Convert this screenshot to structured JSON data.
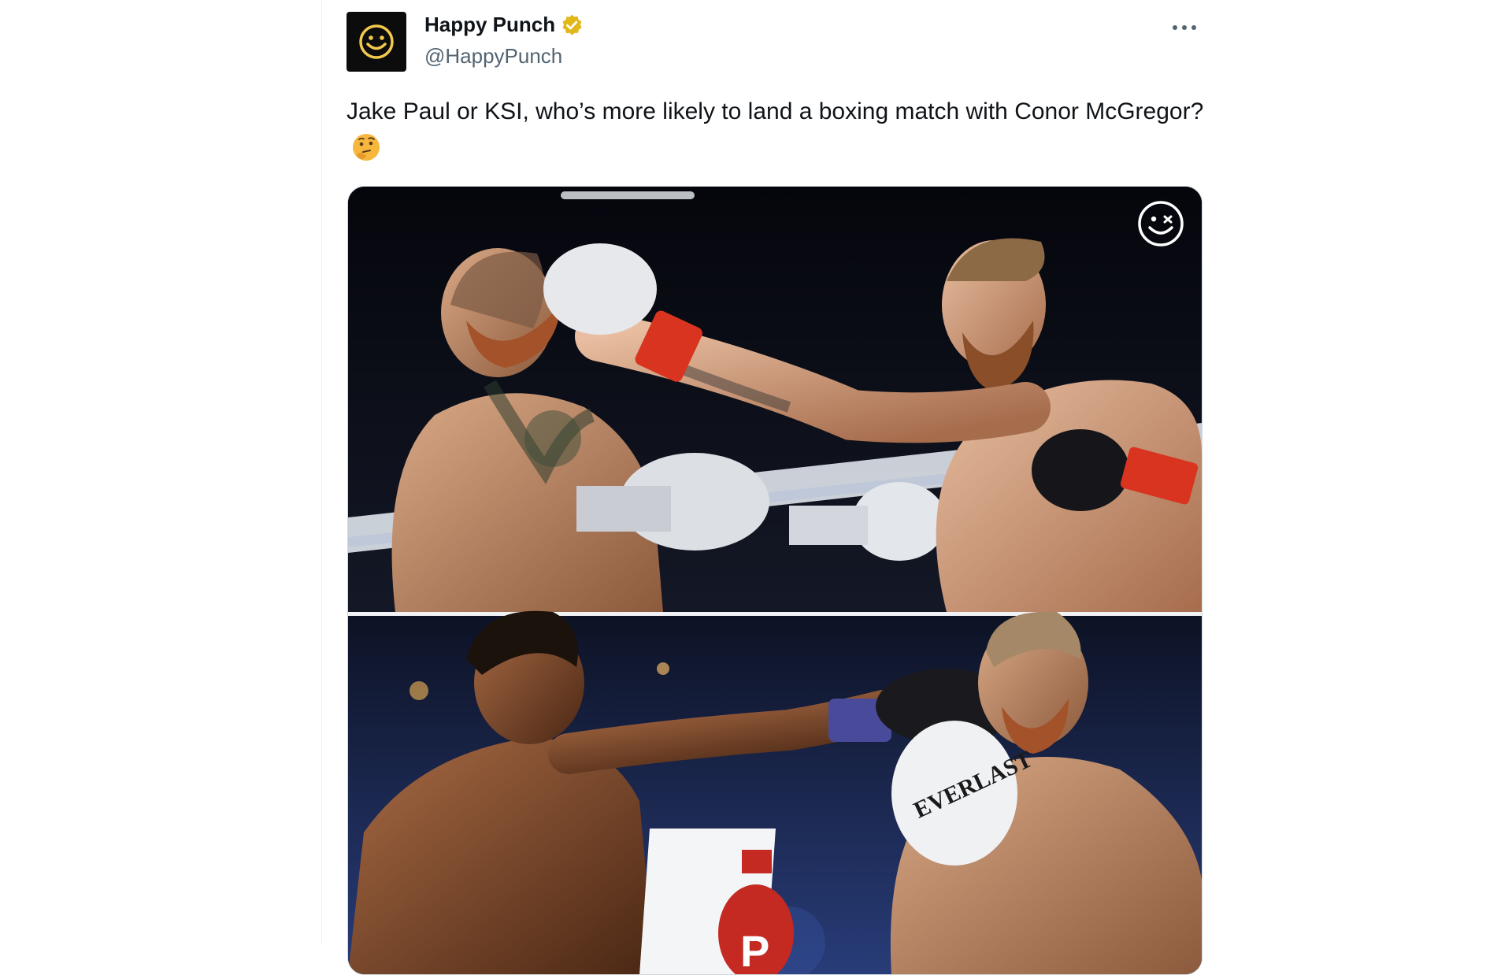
{
  "tweet": {
    "author": {
      "display_name": "Happy Punch",
      "handle": "@HappyPunch",
      "verified": true,
      "verified_badge_color": "#e2b719",
      "avatar_icon": "smiley-face-icon",
      "avatar_bg": "#0c0c0c",
      "avatar_fg": "#f2c94c"
    },
    "text": "Jake Paul or KSI, who’s more likely to land a boxing match with Conor McGregor?",
    "emoji_icon": "thinking-face-icon",
    "more_icon": "more-options-icon",
    "media": {
      "type": "photo-collage",
      "watermark_icon": "winking-smiley-icon",
      "printed_text": [
        "EVERLAST",
        "P"
      ]
    }
  },
  "colors": {
    "text_primary": "#0f1419",
    "text_secondary": "#536471",
    "border": "#cfd9de"
  }
}
